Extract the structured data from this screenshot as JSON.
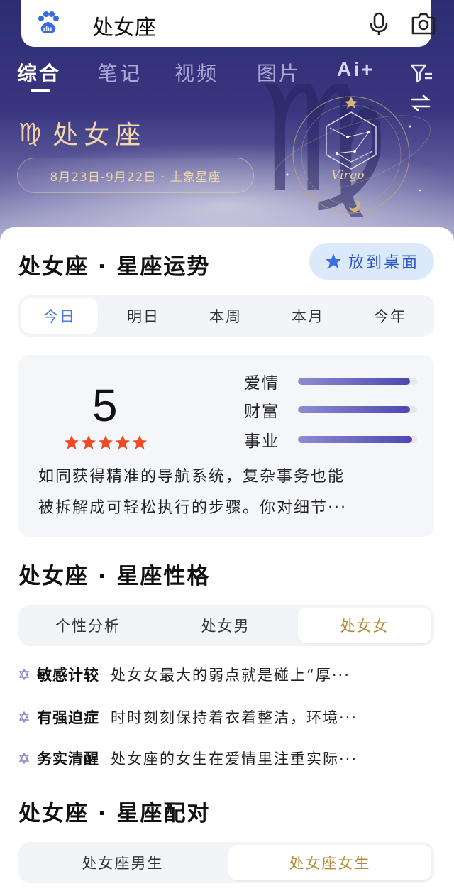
{
  "search": {
    "query": "处女座"
  },
  "tabs": [
    {
      "label": "综合",
      "active": true
    },
    {
      "label": "笔记"
    },
    {
      "label": "视频"
    },
    {
      "label": "图片"
    },
    {
      "label": "Ai+"
    }
  ],
  "hero": {
    "sign_glyph": "♍",
    "sign_name": "处女座",
    "date_range": "8月23日-9月22日 · 土象星座",
    "art_label": "Virgo"
  },
  "horoscope": {
    "title": "处女座 · 星座运势",
    "desk_button": "放到桌面",
    "periods": [
      "今日",
      "明日",
      "本周",
      "本月",
      "今年"
    ],
    "active_period": "今日",
    "score": "5",
    "star_rating": 5,
    "bars": [
      {
        "label": "爱情",
        "level": 0.94
      },
      {
        "label": "财富",
        "level": 0.94
      },
      {
        "label": "事业",
        "level": 0.96
      }
    ],
    "summary_line1": "如同获得精准的导航系统，复杂事务也能",
    "summary_line2": "被拆解成可轻松执行的步骤。你对细节···"
  },
  "personality": {
    "title": "处女座 · 星座性格",
    "tabs": [
      "个性分析",
      "处女男",
      "处女女"
    ],
    "active_tab": "处女女",
    "traits": [
      {
        "keyword": "敏感计较",
        "text": "处女女最大的弱点就是碰上“厚···"
      },
      {
        "keyword": "有强迫症",
        "text": "时时刻刻保持着衣着整洁，环境···"
      },
      {
        "keyword": "务实清醒",
        "text": "处女座的女生在爱情里注重实际···"
      }
    ]
  },
  "match": {
    "title": "处女座 · 星座配对",
    "tabs": [
      "处女座男生",
      "处女座女生"
    ],
    "active_tab": "处女座女生"
  },
  "colors": {
    "hero_top": "#2d2d74",
    "accent_blue": "#4a79d6",
    "accent_gold": "#b58a3a",
    "star_red": "#f04a23",
    "bar_purple": "#4d48b0"
  }
}
